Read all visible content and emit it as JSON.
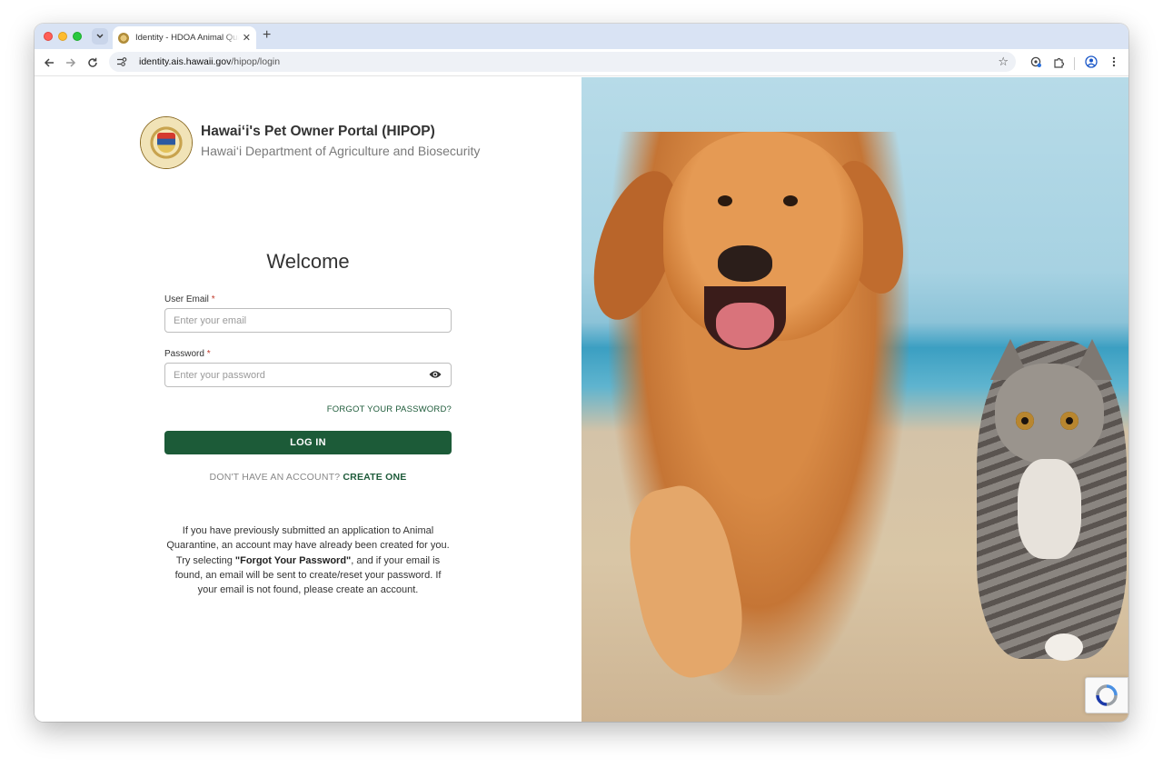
{
  "browser": {
    "tab_title": "Identity - HDOA Animal Quarantine",
    "url_host": "identity.ais.hawaii.gov",
    "url_path": "/hipop/login"
  },
  "brand": {
    "title": "Hawai‘i's Pet Owner Portal (HIPOP)",
    "subtitle": "Hawai‘i Department of Agriculture and Biosecurity",
    "seal_text": "STATE OF HAWAII"
  },
  "form": {
    "heading": "Welcome",
    "email_label": "User Email",
    "email_placeholder": "Enter your email",
    "email_value": "",
    "password_label": "Password",
    "password_placeholder": "Enter your password",
    "password_value": "",
    "required_marker": "*",
    "forgot_link": "FORGOT YOUR PASSWORD?",
    "login_button": "LOG IN",
    "signup_prompt": "DON'T HAVE AN ACCOUNT?",
    "signup_link": "CREATE ONE"
  },
  "info": {
    "part1": "If you have previously submitted an application to Animal Quarantine, an account may have already been created for you. Try selecting ",
    "bold": "\"Forgot Your Password\"",
    "part2": ", and if your email is found, an email will be sent to create/reset your password. If your email is not found, please create an account."
  },
  "colors": {
    "primary": "#1c5b38",
    "required": "#c0392b"
  },
  "icons": {
    "back": "arrow-left",
    "forward": "arrow-right",
    "reload": "reload",
    "site_info": "tune",
    "bookmark": "star",
    "password_visibility": "eye",
    "captcha": "recaptcha"
  }
}
